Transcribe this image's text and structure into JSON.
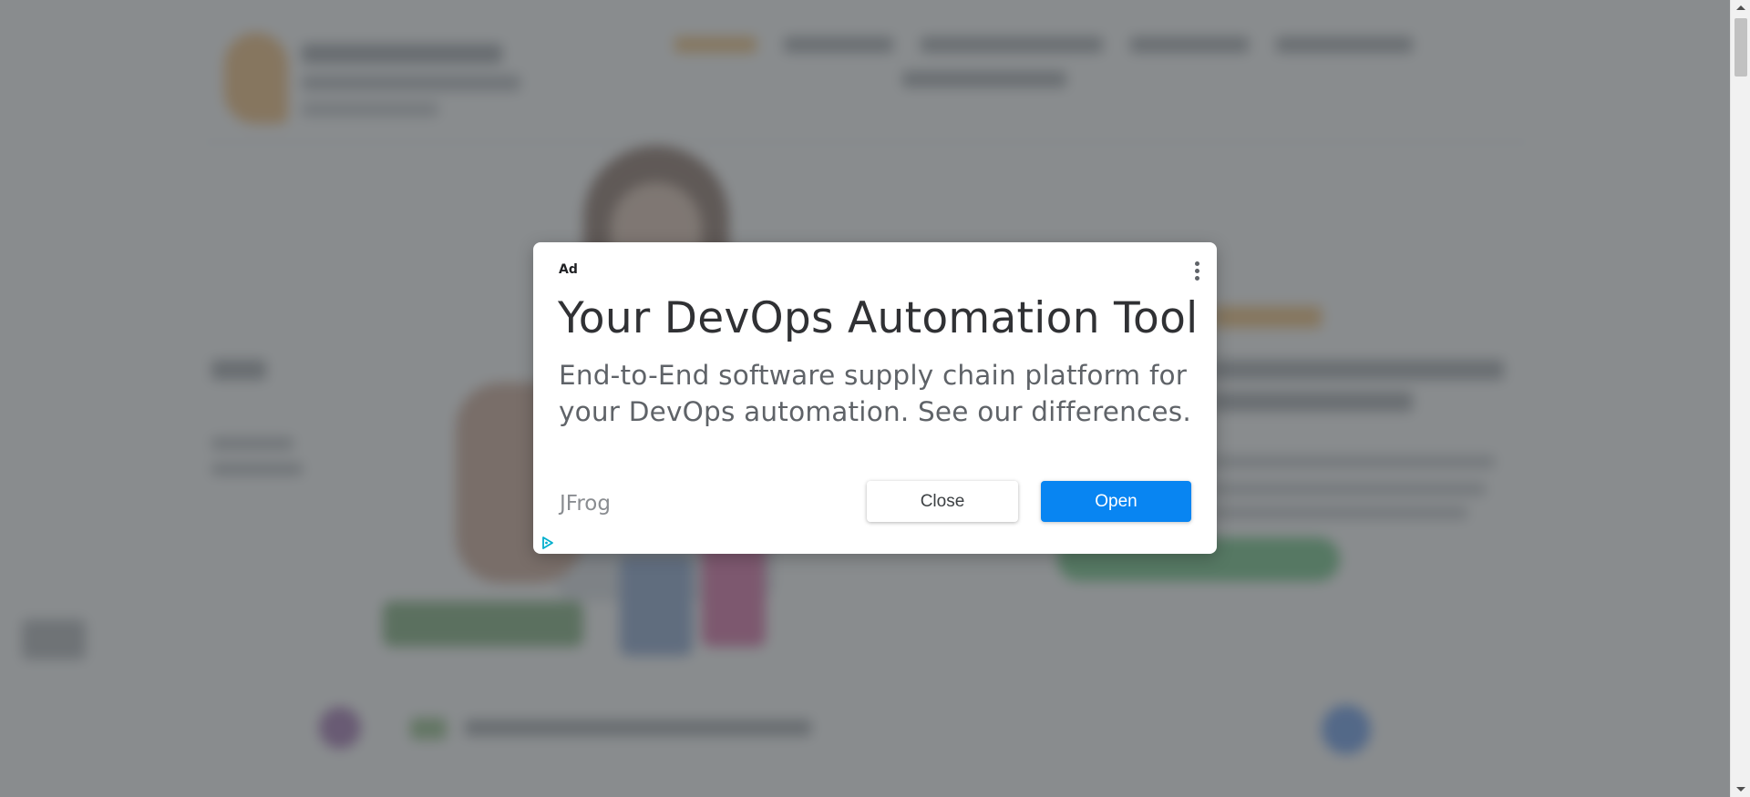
{
  "ad": {
    "label": "Ad",
    "menu_icon": "more-vert-icon",
    "headline": "Your DevOps Automation Tool",
    "body": "End-to-End software supply chain platform for your DevOps automation. See our differences.",
    "advertiser": "JFrog",
    "close_label": "Close",
    "open_label": "Open",
    "adchoices_icon": "adchoices-icon"
  },
  "colors": {
    "open_button": "#0885f2",
    "overlay": "#5b5f63",
    "headline_text": "#303134",
    "body_text": "#5f6368"
  }
}
